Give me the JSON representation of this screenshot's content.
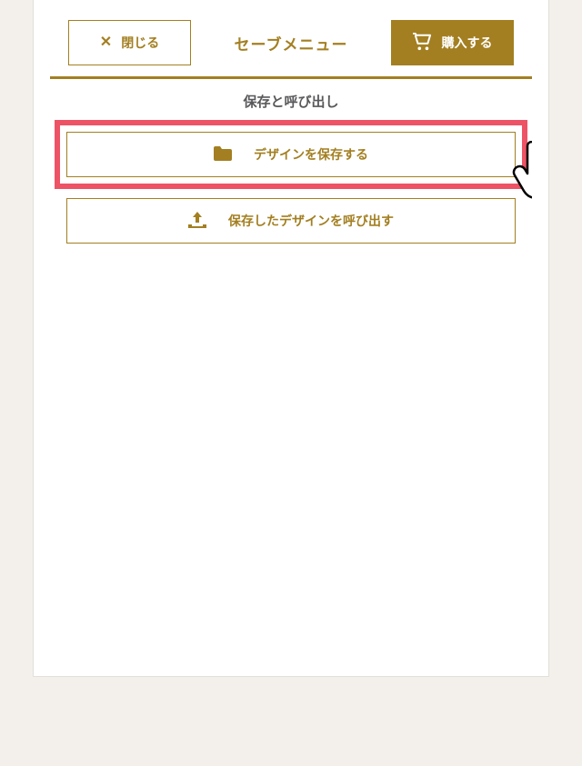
{
  "header": {
    "close_label": "閉じる",
    "title": "セーブメニュー",
    "buy_label": "購入する"
  },
  "section": {
    "title": "保存と呼び出し",
    "save_label": "デザインを保存する",
    "load_label": "保存したデザインを呼び出す"
  },
  "colors": {
    "accent": "#a37f21",
    "highlight": "#ed5365"
  }
}
